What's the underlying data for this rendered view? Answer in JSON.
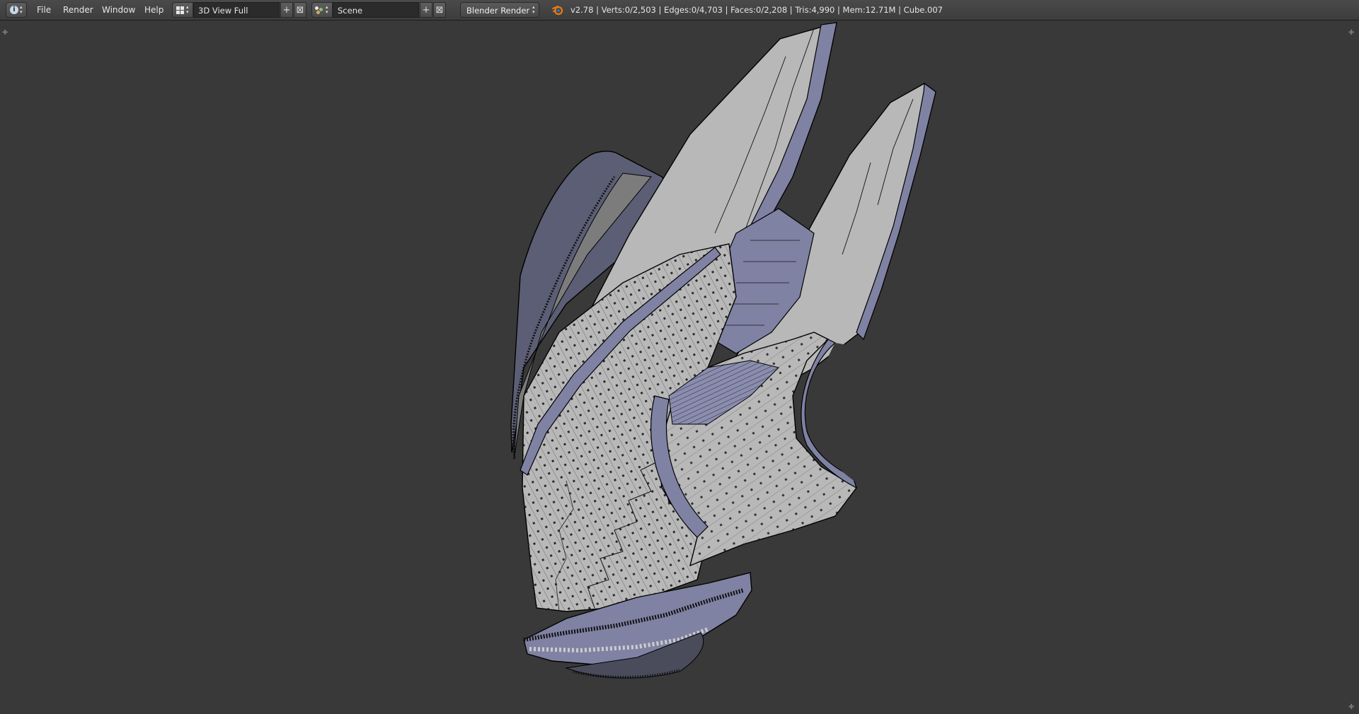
{
  "menu": [
    "File",
    "Render",
    "Window",
    "Help"
  ],
  "layout": {
    "name": "3D View Full"
  },
  "scene": {
    "name": "Scene"
  },
  "render_engine": "Blender Render",
  "info": {
    "stats": "v2.78 | Verts:0/2,503 | Edges:0/4,703 | Faces:0/2,208 | Tris:4,990 | Mem:12.71M | Cube.007"
  },
  "icons": {
    "editor_type": "info-icon",
    "layout": "screen-layout-icon",
    "scene": "scene-icon",
    "add": "plus-icon",
    "remove": "x-icon",
    "logo": "blender-logo-icon"
  },
  "colors": {
    "background": "#393939",
    "header": "#444444",
    "mesh_face": "#b4b4b4",
    "mesh_side": "#7f82a3",
    "wire": "#000000"
  }
}
